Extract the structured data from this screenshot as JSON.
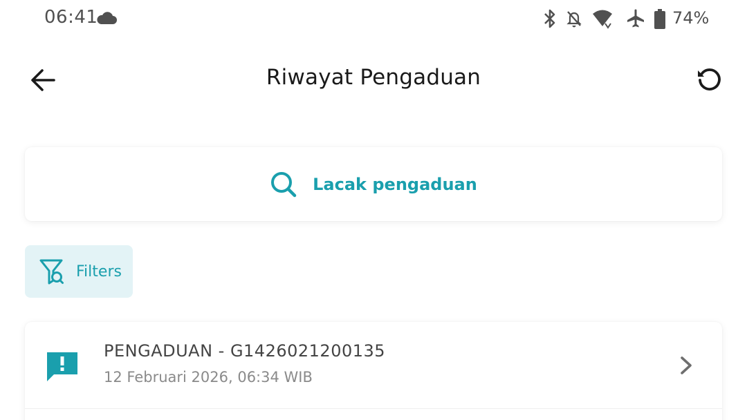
{
  "status_bar": {
    "time": "06:41",
    "battery_percent": "74%",
    "icons": [
      "cloud-icon",
      "bluetooth-icon",
      "notifications-off-icon",
      "wifi-icon",
      "airplane-mode-icon",
      "battery-icon"
    ]
  },
  "app_bar": {
    "title": "Riwayat Pengaduan",
    "back_icon": "arrow-left-icon",
    "refresh_icon": "refresh-icon"
  },
  "track": {
    "label": "Lacak pengaduan",
    "icon": "search-icon"
  },
  "filters": {
    "label": "Filters",
    "icon": "filter-search-icon"
  },
  "complaints": [
    {
      "title": "PENGADUAN - G1426021200135",
      "datetime": "12 Februari 2026, 06:34 WIB",
      "icon": "complaint-alert-icon"
    }
  ],
  "colors": {
    "accent": "#1a9fad",
    "chip_background": "#e3f3f6",
    "text_primary": "#1a1a1a",
    "text_secondary": "#8a8a8a"
  }
}
